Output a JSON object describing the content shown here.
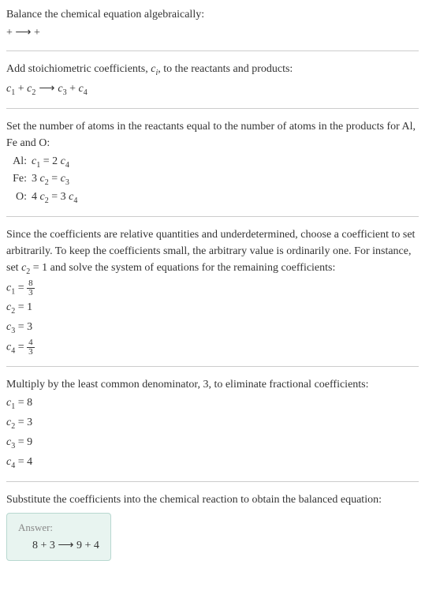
{
  "intro": {
    "l1": "Balance the chemical equation algebraically:",
    "l2": " +  ⟶  + "
  },
  "stoich": {
    "l1": "Add stoichiometric coefficients, ",
    "l1_var": "c",
    "l1_sub": "i",
    "l1_rest": ", to the reactants and products:",
    "eq_c1": "c",
    "eq_s1": "1",
    "eq_plus1": " + ",
    "eq_c2": "c",
    "eq_s2": "2",
    "eq_arrow": " ⟶ ",
    "eq_c3": "c",
    "eq_s3": "3",
    "eq_plus2": " + ",
    "eq_c4": "c",
    "eq_s4": "4"
  },
  "atoms": {
    "l1": "Set the number of atoms in the reactants equal to the number of atoms in the products for Al, Fe and O:",
    "rows": [
      {
        "label": "Al:",
        "c_left": "c",
        "s_left": "1",
        "eq": " = 2 ",
        "c_right": "c",
        "s_right": "4"
      },
      {
        "label": "Fe:",
        "pre": "3 ",
        "c_left": "c",
        "s_left": "2",
        "eq": " = ",
        "c_right": "c",
        "s_right": "3"
      },
      {
        "label": "O:",
        "pre": "4 ",
        "c_left": "c",
        "s_left": "2",
        "eq": " = 3 ",
        "c_right": "c",
        "s_right": "4"
      }
    ]
  },
  "choose": {
    "l1": "Since the coefficients are relative quantities and underdetermined, choose a coefficient to set arbitrarily. To keep the coefficients small, the arbitrary value is ordinarily one. For instance, set ",
    "l1_c": "c",
    "l1_s": "2",
    "l1_rest": " = 1 and solve the system of equations for the remaining coefficients:",
    "r1_c": "c",
    "r1_s": "1",
    "r1_eq": " = ",
    "r1_num": "8",
    "r1_den": "3",
    "r2_c": "c",
    "r2_s": "2",
    "r2_eq": " = 1",
    "r3_c": "c",
    "r3_s": "3",
    "r3_eq": " = 3",
    "r4_c": "c",
    "r4_s": "4",
    "r4_eq": " = ",
    "r4_num": "4",
    "r4_den": "3"
  },
  "mult": {
    "l1": "Multiply by the least common denominator, 3, to eliminate fractional coefficients:",
    "r1_c": "c",
    "r1_s": "1",
    "r1_eq": " = 8",
    "r2_c": "c",
    "r2_s": "2",
    "r2_eq": " = 3",
    "r3_c": "c",
    "r3_s": "3",
    "r3_eq": " = 9",
    "r4_c": "c",
    "r4_s": "4",
    "r4_eq": " = 4"
  },
  "subst": {
    "l1": "Substitute the coefficients into the chemical reaction to obtain the balanced equation:"
  },
  "answer": {
    "label": "Answer:",
    "eq": "8  + 3  ⟶ 9  + 4 "
  }
}
